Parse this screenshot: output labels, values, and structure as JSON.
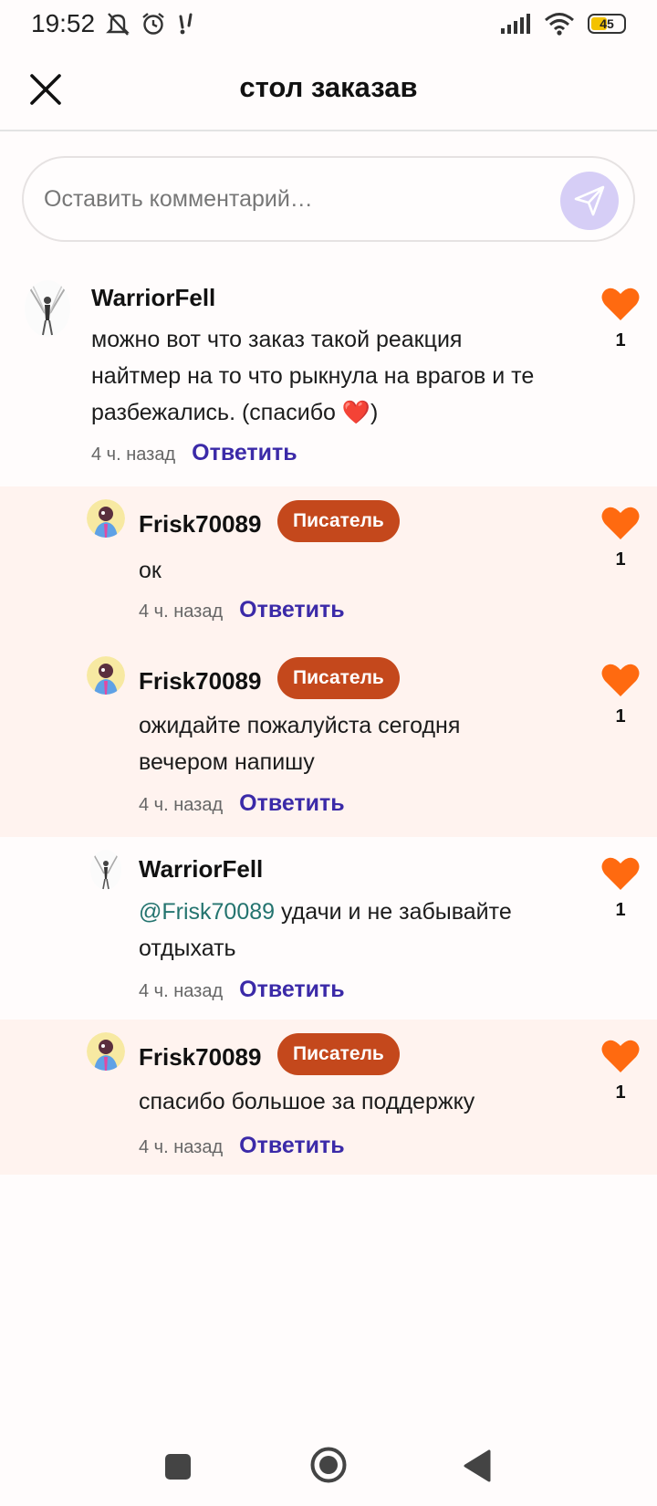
{
  "status": {
    "time": "19:52",
    "battery": "45",
    "icons_left": [
      "mute-icon",
      "alarm-icon",
      "notification-icon"
    ],
    "icons_right": [
      "signal-icon",
      "wifi-icon",
      "battery-icon"
    ]
  },
  "header": {
    "title": "стол заказав",
    "close_icon": "close-icon"
  },
  "comment_input": {
    "placeholder": "Оставить комментарий…",
    "send_icon": "send-icon"
  },
  "colors": {
    "like": "#ff6a10",
    "badge": "#c4481c",
    "reply_link": "#3b2aa8",
    "mention": "#24746f",
    "highlight_bg": "#fff3ef"
  },
  "comments": [
    {
      "author": "WarriorFell",
      "text": "можно вот что заказ такой реакция найтмер на то что  рыкнула на врагов и те разбежались. (спасибо ❤️)",
      "time": "4 ч. назад",
      "reply": "Ответить",
      "likes": "1"
    },
    {
      "author": "Frisk70089",
      "badge": "Писатель",
      "text": "ок",
      "time": "4 ч. назад",
      "reply": "Ответить",
      "likes": "1"
    },
    {
      "author": "Frisk70089",
      "badge": "Писатель",
      "text": "ожидайте пожалуйста сегодня вечером напишу",
      "time": "4 ч. назад",
      "reply": "Ответить",
      "likes": "1"
    },
    {
      "author": "WarriorFell",
      "mention": "@Frisk70089",
      "text": " удачи и не забывайте отдыхать",
      "time": "4 ч. назад",
      "reply": "Ответить",
      "likes": "1"
    },
    {
      "author": "Frisk70089",
      "badge": "Писатель",
      "text": "спасибо большое за поддержку",
      "time": "4 ч. назад",
      "reply": "Ответить",
      "likes": "1"
    }
  ],
  "nav": [
    "recents-button",
    "home-button",
    "back-button"
  ]
}
